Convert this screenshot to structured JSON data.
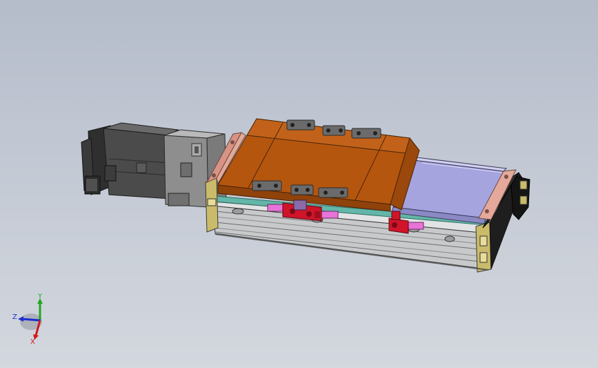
{
  "viewport": {
    "background_top": "#b5bcca",
    "background_bottom": "#d3d7de"
  },
  "model": {
    "carriage_color": "#b5560f",
    "cover_color": "#a6a4df",
    "rail_color": "#c7c9cb",
    "end_plate_color": "#e4a99a",
    "motor_color": "#4b4b4b",
    "sensor_color": "#d0142a",
    "sensor_flag_color": "#e774d8",
    "strip_color": "#63b6a8",
    "brass_color": "#c9bb6a"
  },
  "triad": {
    "x_label": "X",
    "y_label": "Y",
    "z_label": "Z",
    "x_color": "#d01a1a",
    "y_color": "#1ea81e",
    "z_color": "#1a2fd0"
  }
}
